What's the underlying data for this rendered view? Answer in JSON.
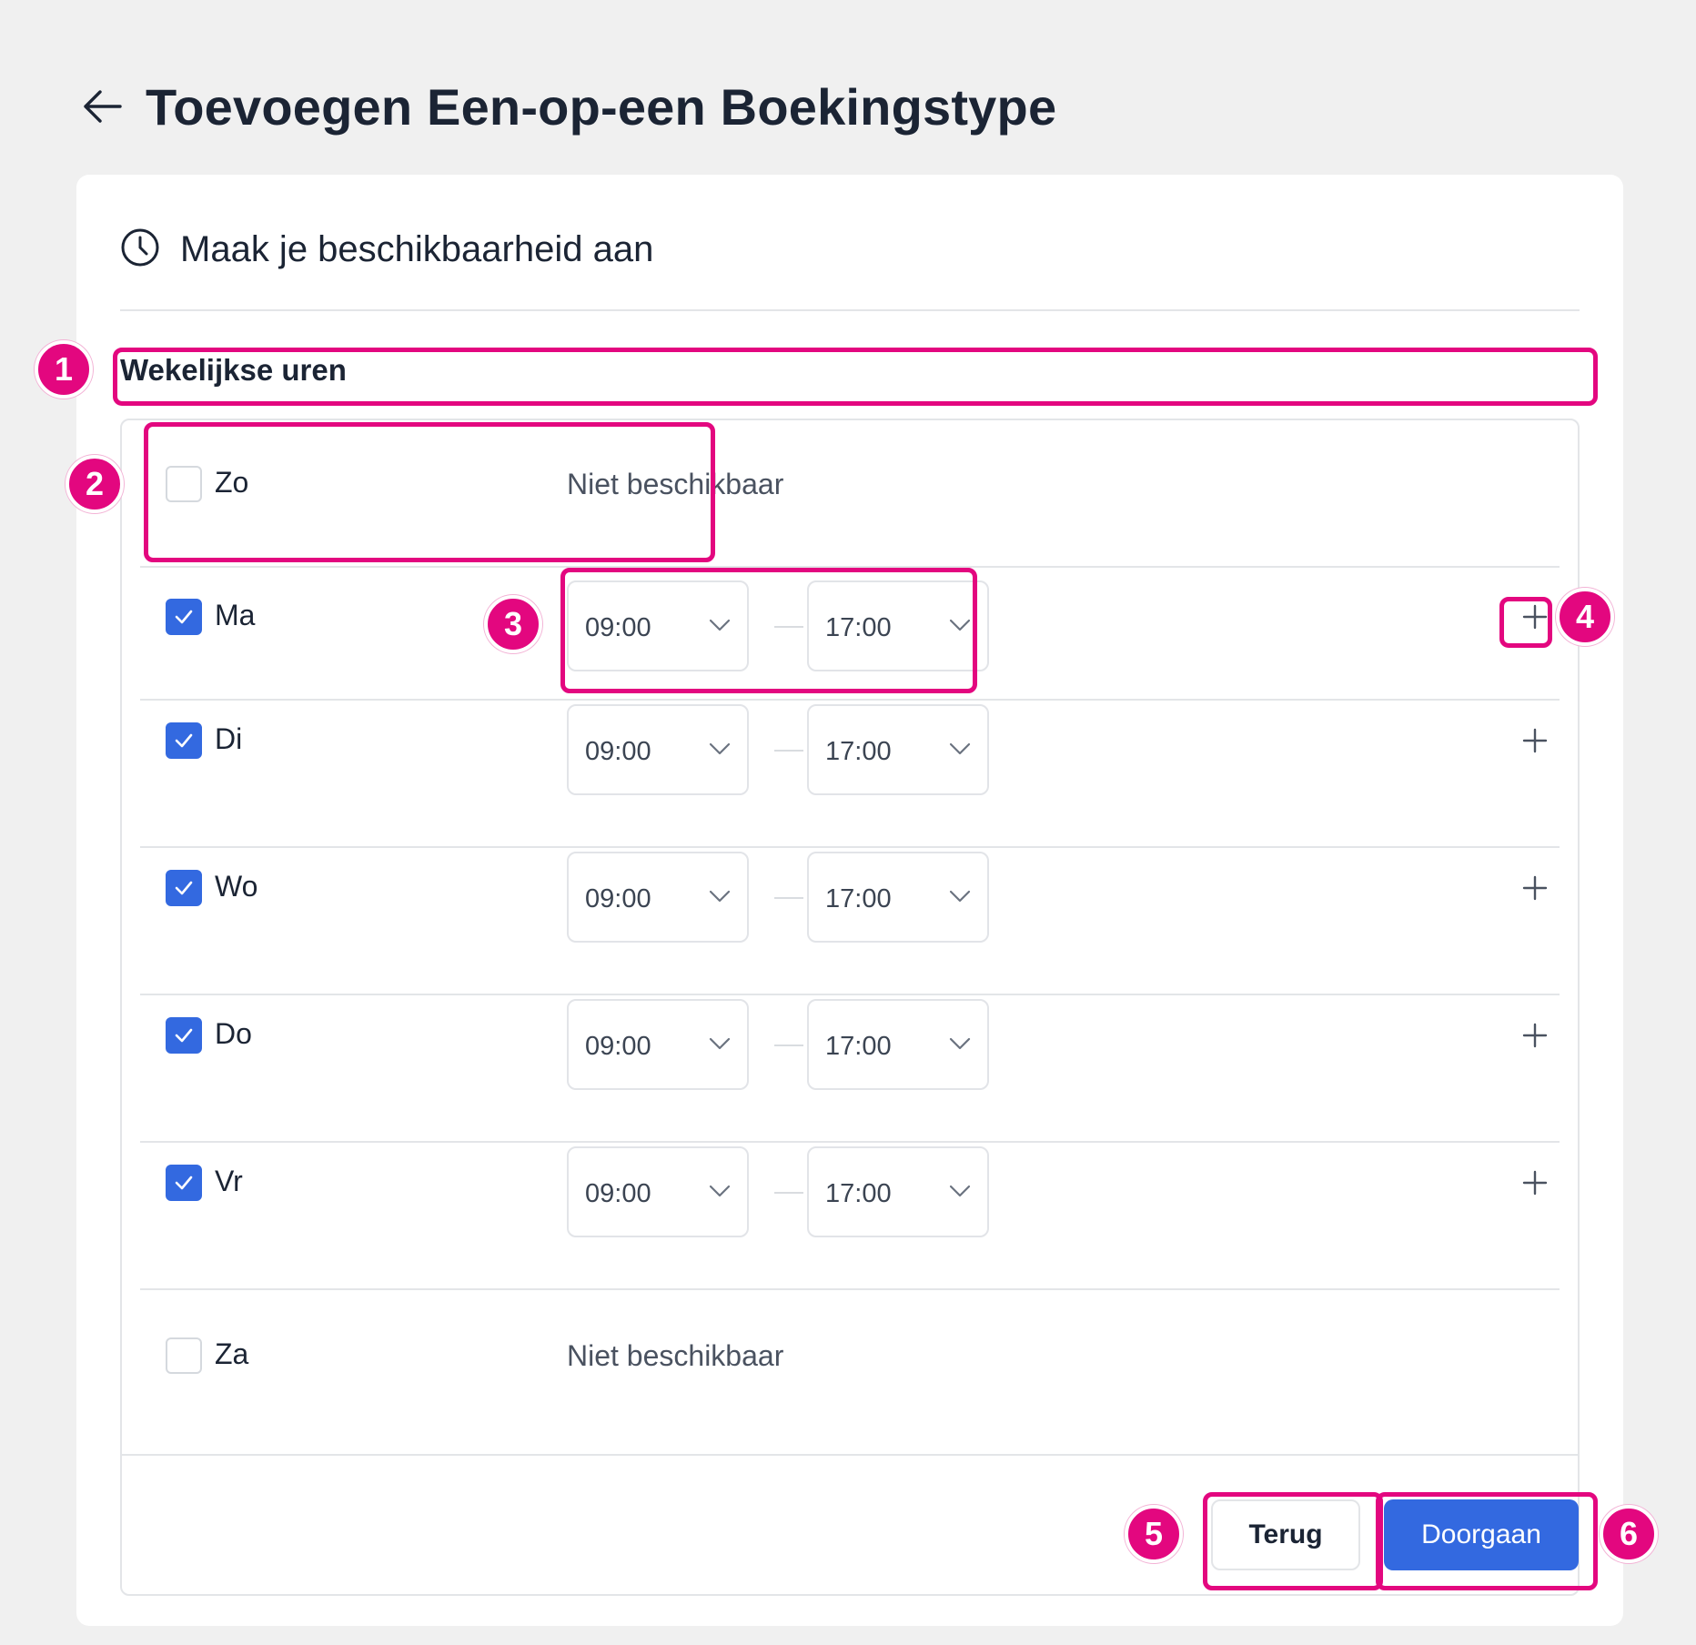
{
  "header": {
    "title": "Toevoegen Een-op-een Boekingstype"
  },
  "card": {
    "title": "Maak je beschikbaarheid aan"
  },
  "section": {
    "label": "Wekelijkse uren"
  },
  "days": [
    {
      "label": "Zo",
      "checked": false,
      "unavailable_text": "Niet beschikbaar"
    },
    {
      "label": "Ma",
      "checked": true,
      "start": "09:00",
      "end": "17:00"
    },
    {
      "label": "Di",
      "checked": true,
      "start": "09:00",
      "end": "17:00"
    },
    {
      "label": "Wo",
      "checked": true,
      "start": "09:00",
      "end": "17:00"
    },
    {
      "label": "Do",
      "checked": true,
      "start": "09:00",
      "end": "17:00"
    },
    {
      "label": "Vr",
      "checked": true,
      "start": "09:00",
      "end": "17:00"
    },
    {
      "label": "Za",
      "checked": false,
      "unavailable_text": "Niet beschikbaar"
    }
  ],
  "buttons": {
    "back_label": "Terug",
    "continue_label": "Doorgaan"
  },
  "annotations": [
    "1",
    "2",
    "3",
    "4",
    "5",
    "6"
  ],
  "colors": {
    "accent": "#3369e0",
    "annotation": "#e3077f",
    "background": "#f0f0f0"
  }
}
